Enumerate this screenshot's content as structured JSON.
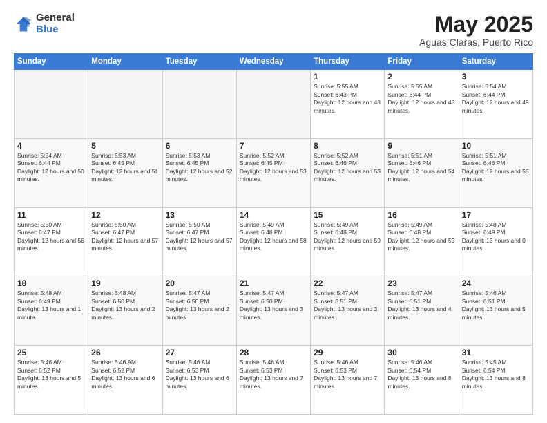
{
  "header": {
    "logo_general": "General",
    "logo_blue": "Blue",
    "month_title": "May 2025",
    "location": "Aguas Claras, Puerto Rico"
  },
  "days_of_week": [
    "Sunday",
    "Monday",
    "Tuesday",
    "Wednesday",
    "Thursday",
    "Friday",
    "Saturday"
  ],
  "weeks": [
    [
      {
        "day": "",
        "empty": true
      },
      {
        "day": "",
        "empty": true
      },
      {
        "day": "",
        "empty": true
      },
      {
        "day": "",
        "empty": true
      },
      {
        "day": "1",
        "sunrise": "5:55 AM",
        "sunset": "6:43 PM",
        "daylight": "12 hours and 48 minutes."
      },
      {
        "day": "2",
        "sunrise": "5:55 AM",
        "sunset": "6:44 PM",
        "daylight": "12 hours and 48 minutes."
      },
      {
        "day": "3",
        "sunrise": "5:54 AM",
        "sunset": "6:44 PM",
        "daylight": "12 hours and 49 minutes."
      }
    ],
    [
      {
        "day": "4",
        "sunrise": "5:54 AM",
        "sunset": "6:44 PM",
        "daylight": "12 hours and 50 minutes."
      },
      {
        "day": "5",
        "sunrise": "5:53 AM",
        "sunset": "6:45 PM",
        "daylight": "12 hours and 51 minutes."
      },
      {
        "day": "6",
        "sunrise": "5:53 AM",
        "sunset": "6:45 PM",
        "daylight": "12 hours and 52 minutes."
      },
      {
        "day": "7",
        "sunrise": "5:52 AM",
        "sunset": "6:45 PM",
        "daylight": "12 hours and 53 minutes."
      },
      {
        "day": "8",
        "sunrise": "5:52 AM",
        "sunset": "6:46 PM",
        "daylight": "12 hours and 53 minutes."
      },
      {
        "day": "9",
        "sunrise": "5:51 AM",
        "sunset": "6:46 PM",
        "daylight": "12 hours and 54 minutes."
      },
      {
        "day": "10",
        "sunrise": "5:51 AM",
        "sunset": "6:46 PM",
        "daylight": "12 hours and 55 minutes."
      }
    ],
    [
      {
        "day": "11",
        "sunrise": "5:50 AM",
        "sunset": "6:47 PM",
        "daylight": "12 hours and 56 minutes."
      },
      {
        "day": "12",
        "sunrise": "5:50 AM",
        "sunset": "6:47 PM",
        "daylight": "12 hours and 57 minutes."
      },
      {
        "day": "13",
        "sunrise": "5:50 AM",
        "sunset": "6:47 PM",
        "daylight": "12 hours and 57 minutes."
      },
      {
        "day": "14",
        "sunrise": "5:49 AM",
        "sunset": "6:48 PM",
        "daylight": "12 hours and 58 minutes."
      },
      {
        "day": "15",
        "sunrise": "5:49 AM",
        "sunset": "6:48 PM",
        "daylight": "12 hours and 59 minutes."
      },
      {
        "day": "16",
        "sunrise": "5:49 AM",
        "sunset": "6:48 PM",
        "daylight": "12 hours and 59 minutes."
      },
      {
        "day": "17",
        "sunrise": "5:48 AM",
        "sunset": "6:49 PM",
        "daylight": "13 hours and 0 minutes."
      }
    ],
    [
      {
        "day": "18",
        "sunrise": "5:48 AM",
        "sunset": "6:49 PM",
        "daylight": "13 hours and 1 minute."
      },
      {
        "day": "19",
        "sunrise": "5:48 AM",
        "sunset": "6:50 PM",
        "daylight": "13 hours and 2 minutes."
      },
      {
        "day": "20",
        "sunrise": "5:47 AM",
        "sunset": "6:50 PM",
        "daylight": "13 hours and 2 minutes."
      },
      {
        "day": "21",
        "sunrise": "5:47 AM",
        "sunset": "6:50 PM",
        "daylight": "13 hours and 3 minutes."
      },
      {
        "day": "22",
        "sunrise": "5:47 AM",
        "sunset": "6:51 PM",
        "daylight": "13 hours and 3 minutes."
      },
      {
        "day": "23",
        "sunrise": "5:47 AM",
        "sunset": "6:51 PM",
        "daylight": "13 hours and 4 minutes."
      },
      {
        "day": "24",
        "sunrise": "5:46 AM",
        "sunset": "6:51 PM",
        "daylight": "13 hours and 5 minutes."
      }
    ],
    [
      {
        "day": "25",
        "sunrise": "5:46 AM",
        "sunset": "6:52 PM",
        "daylight": "13 hours and 5 minutes."
      },
      {
        "day": "26",
        "sunrise": "5:46 AM",
        "sunset": "6:52 PM",
        "daylight": "13 hours and 6 minutes."
      },
      {
        "day": "27",
        "sunrise": "5:46 AM",
        "sunset": "6:53 PM",
        "daylight": "13 hours and 6 minutes."
      },
      {
        "day": "28",
        "sunrise": "5:46 AM",
        "sunset": "6:53 PM",
        "daylight": "13 hours and 7 minutes."
      },
      {
        "day": "29",
        "sunrise": "5:46 AM",
        "sunset": "6:53 PM",
        "daylight": "13 hours and 7 minutes."
      },
      {
        "day": "30",
        "sunrise": "5:46 AM",
        "sunset": "6:54 PM",
        "daylight": "13 hours and 8 minutes."
      },
      {
        "day": "31",
        "sunrise": "5:45 AM",
        "sunset": "6:54 PM",
        "daylight": "13 hours and 8 minutes."
      }
    ]
  ]
}
